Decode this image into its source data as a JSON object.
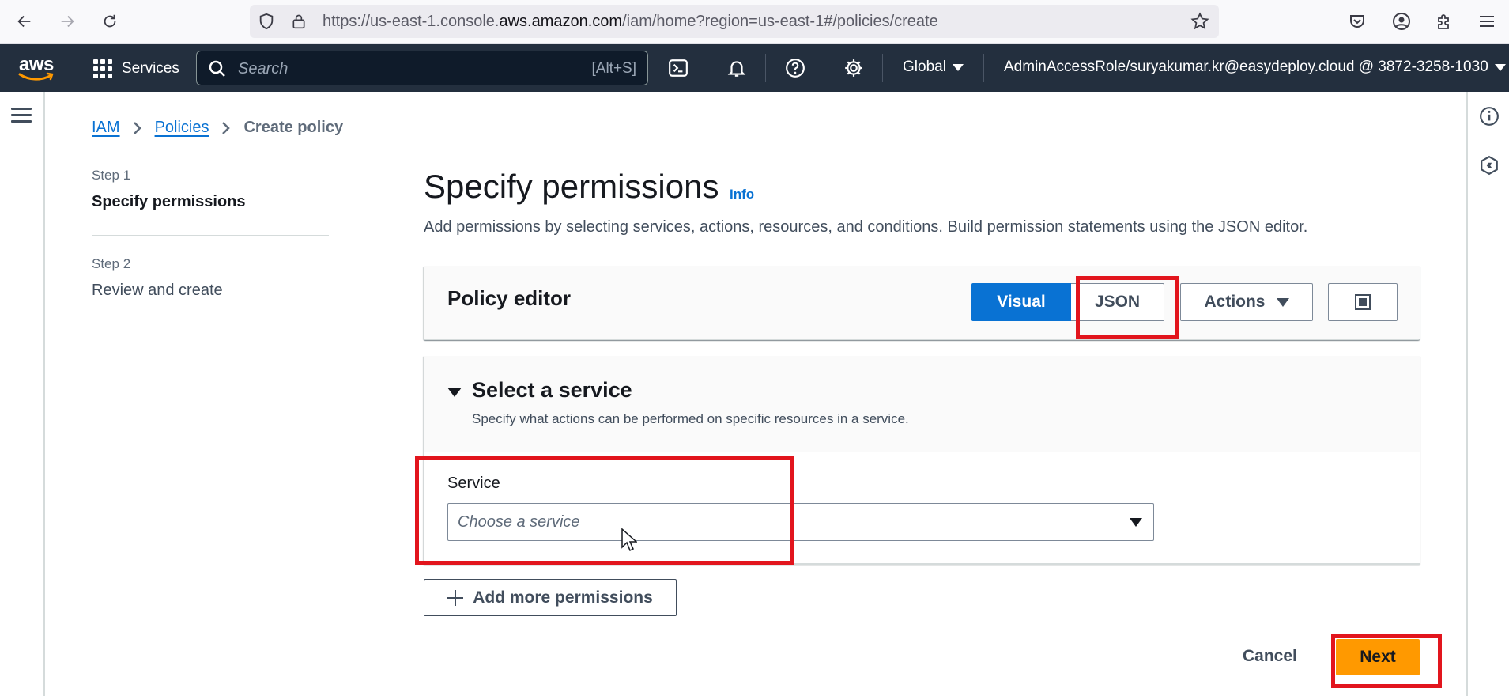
{
  "browser": {
    "url_prefix": "https://us-east-1.console.",
    "url_domain": "aws.amazon.com",
    "url_suffix": "/iam/home?region=us-east-1#/policies/create"
  },
  "aws_nav": {
    "logo_text": "aws",
    "services_label": "Services",
    "search_placeholder": "Search",
    "search_shortcut": "[Alt+S]",
    "region_label": "Global",
    "account_label": "AdminAccessRole/suryakumar.kr@easydeploy.cloud @ 3872-3258-1030"
  },
  "breadcrumb": {
    "items": [
      "IAM",
      "Policies",
      "Create policy"
    ]
  },
  "steps": [
    {
      "label": "Step 1",
      "title": "Specify permissions"
    },
    {
      "label": "Step 2",
      "title": "Review and create"
    }
  ],
  "page": {
    "title": "Specify permissions",
    "info": "Info",
    "description": "Add permissions by selecting services, actions, resources, and conditions. Build permission statements using the JSON editor."
  },
  "editor": {
    "title": "Policy editor",
    "visual_label": "Visual",
    "json_label": "JSON",
    "actions_label": "Actions"
  },
  "service_section": {
    "title": "Select a service",
    "description": "Specify what actions can be performed on specific resources in a service.",
    "field_label": "Service",
    "placeholder": "Choose a service"
  },
  "footer": {
    "add_permissions_label": "Add more permissions",
    "cancel_label": "Cancel",
    "next_label": "Next"
  },
  "colors": {
    "aws_nav_bg": "#232f3e",
    "primary_blue": "#0972d3",
    "next_orange": "#ff9900",
    "highlight_red": "#e2151d"
  }
}
